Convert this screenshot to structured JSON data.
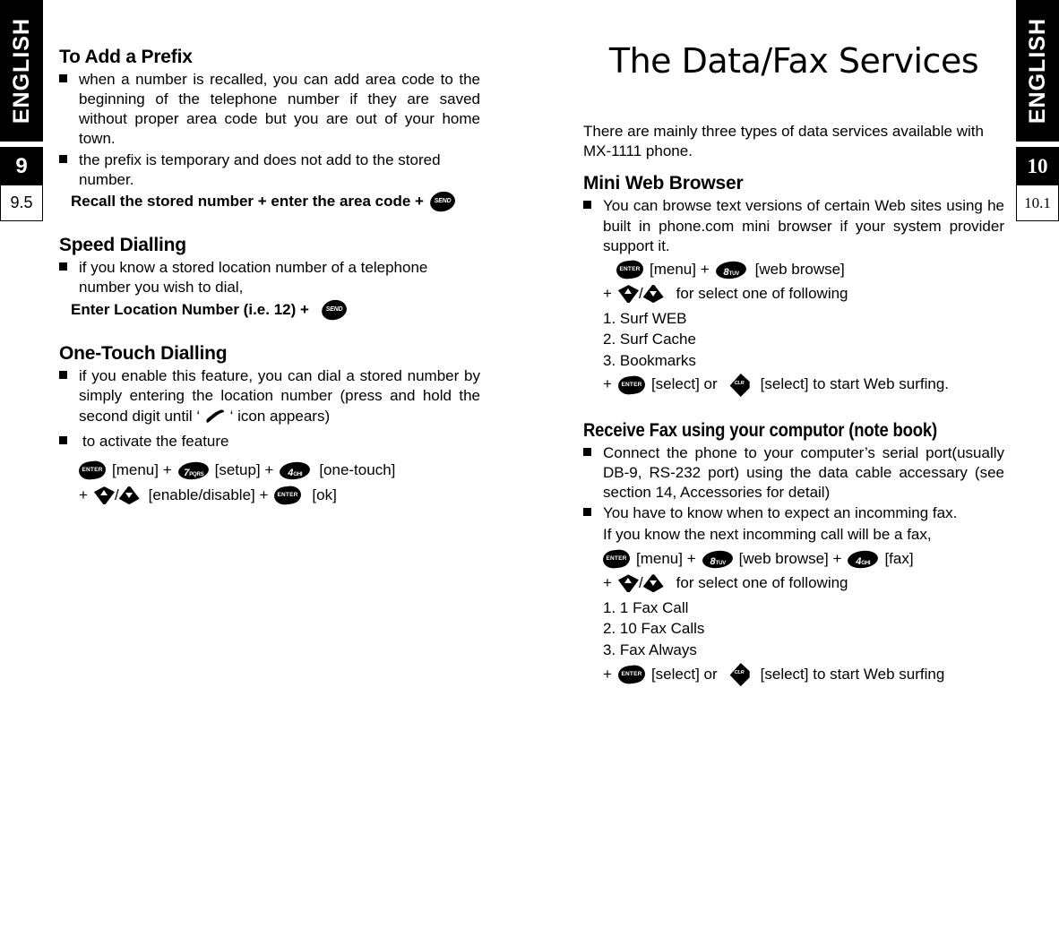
{
  "left_tab": {
    "language": "ENGLISH",
    "chapter": "9",
    "section": "9.5"
  },
  "right_tab": {
    "language": "ENGLISH",
    "chapter": "10",
    "section": "10.1"
  },
  "left_column": {
    "prefix": {
      "heading": "To Add a Prefix",
      "bullets": [
        "when a number is recalled, you can add area code to the beginning of the telephone number if they are saved without proper area code but you are out of your home town.",
        "the prefix is temporary and does not add to the stored number."
      ],
      "command_prefix": "Recall the stored number + enter the area code +",
      "command_key": "SEND"
    },
    "speed": {
      "heading": "Speed Dialling",
      "bullets": [
        "if you know a stored location number of a telephone number you wish to dial,"
      ],
      "command_prefix": "Enter Location Number (i.e. 12) +",
      "command_key": "SEND"
    },
    "onetouch": {
      "heading": "One-Touch Dialling",
      "bullet1_a": "if you enable this feature, you can dial a stored number by simply entering the location number (press and hold the second digit until ‘",
      "bullet1_b": "‘ icon appears)",
      "bullet2": "to activate the feature",
      "line1": {
        "key1": "ENTER",
        "label1": "[menu] +",
        "key2_digit": "7",
        "key2_letters": "PQRS",
        "label2": "[setup] +",
        "key3_digit": "4",
        "key3_letters": "GHI",
        "label3": "[one-touch]"
      },
      "line2": {
        "plus": "+",
        "slash": "/",
        "label1": "[enable/disable] +",
        "key_enter": "ENTER",
        "label2": "[ok]"
      }
    }
  },
  "right_column": {
    "title": "The Data/Fax Services",
    "intro": "There are mainly three types of data services available with MX-1111 phone.",
    "browser": {
      "heading": "Mini Web Browser",
      "bullet": "You can browse text versions of certain Web sites using he built in phone.com mini browser if your system provider support it.",
      "line1": {
        "key1": "ENTER",
        "label1": "[menu] +",
        "key2_digit": "8",
        "key2_letters": "TUV",
        "label2": "[web browse]"
      },
      "line2": {
        "plus": "+",
        "slash": "/",
        "label": "for select one of following"
      },
      "options": [
        "1. Surf WEB",
        "2. Surf Cache",
        "3. Bookmarks"
      ],
      "line3": {
        "plus": "+",
        "key1": "ENTER",
        "label1": "[select] or",
        "key2": "CLR",
        "label2": "[select] to start Web surfing."
      }
    },
    "fax": {
      "heading": "Receive Fax using your computor (note book)",
      "bullets": [
        "Connect the phone to your computer’s  serial port(usually DB-9, RS-232 port) using the data cable accessary (see section 14, Accessories for detail)",
        "You have to know when to expect an incomming fax."
      ],
      "note": "If you know the next incomming call will be a fax,",
      "line1": {
        "key1": "ENTER",
        "label1": "[menu] +",
        "key2_digit": "8",
        "key2_letters": "TUV",
        "label2": "[web browse] +",
        "key3_digit": "4",
        "key3_letters": "GHI",
        "label3": "[fax]"
      },
      "line2": {
        "plus": "+",
        "slash": "/",
        "label": "for select one of following"
      },
      "options": [
        "1. 1 Fax Call",
        "2. 10 Fax Calls",
        "3. Fax Always"
      ],
      "line3": {
        "plus": "+",
        "key1": "ENTER",
        "label1": "[select] or",
        "key2": "CLR",
        "label2": "[select] to start Web surfing"
      }
    }
  }
}
